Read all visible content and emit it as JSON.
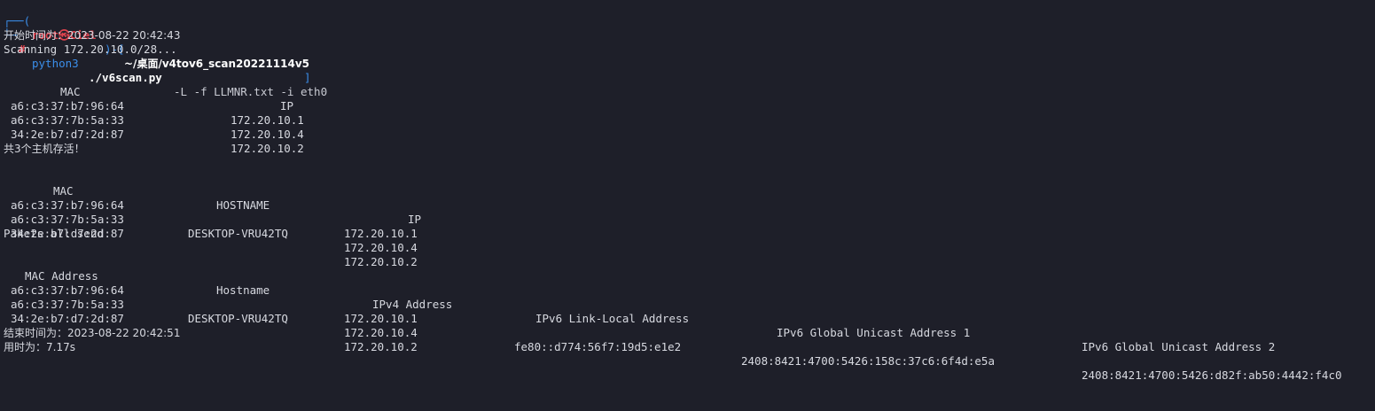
{
  "prompt": {
    "open_bracket": "┌──(",
    "user": "root㉿Ciel",
    "mid": ")-[",
    "path": "~/桌面/v4tov6_scan20221114v5",
    "close_bracket": "]",
    "corner": "└─",
    "symbol": "#",
    "cmd": "python3",
    "script": "./v6scan.py",
    "args": "-L -f LLMNR.txt -i eth0"
  },
  "start_line": "开始时间为：2023-08-22 20:42:43",
  "scanning_line": "Scanning 172.20.10.0/28...",
  "table1": {
    "headers": [
      "MAC",
      "IP"
    ],
    "rows": [
      [
        "a6:c3:37:b7:96:64",
        "172.20.10.1"
      ],
      [
        "a6:c3:37:7b:5a:33",
        "172.20.10.4"
      ],
      [
        "34:2e:b7:d7:2d:87",
        "172.20.10.2"
      ]
    ]
  },
  "alive_line": "共3个主机存活！",
  "table2": {
    "headers": [
      "MAC",
      "HOSTNAME",
      "IP"
    ],
    "rows": [
      [
        "a6:c3:37:b7:96:64",
        "",
        "172.20.10.1"
      ],
      [
        "a6:c3:37:7b:5a:33",
        "DESKTOP-VRU42TQ",
        "172.20.10.4"
      ],
      [
        "34:2e:b7:d7:2d:87",
        "",
        "172.20.10.2"
      ]
    ]
  },
  "pakets_line": "Pakets all send",
  "table3": {
    "headers": [
      "MAC Address",
      "Hostname",
      "IPv4 Address",
      "IPv6 Link-Local Address",
      "IPv6 Global Unicast Address 1",
      "IPv6 Global Unicast Address 2"
    ],
    "rows": [
      [
        "a6:c3:37:b7:96:64",
        "",
        "172.20.10.1",
        "",
        "",
        ""
      ],
      [
        "a6:c3:37:7b:5a:33",
        "DESKTOP-VRU42TQ",
        "172.20.10.4",
        "fe80::d774:56f7:19d5:e1e2",
        "2408:8421:4700:5426:158c:37c6:6f4d:e5a",
        "2408:8421:4700:5426:d82f:ab50:4442:f4c0"
      ],
      [
        "34:2e:b7:d7:2d:87",
        "",
        "172.20.10.2",
        "",
        "",
        ""
      ]
    ]
  },
  "end_line": "结束时间为：2023-08-22 20:42:51",
  "elapsed_line": "用时为：7.17s"
}
